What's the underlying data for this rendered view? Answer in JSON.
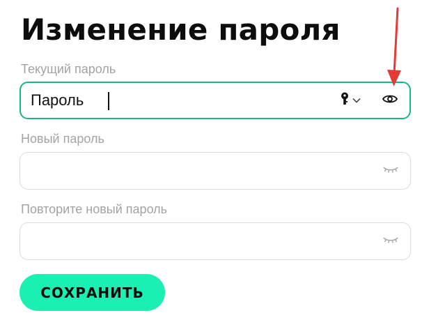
{
  "page": {
    "title": "Изменение пароля"
  },
  "current_password": {
    "label": "Текущий пароль",
    "value": "Пароль",
    "placeholder": ""
  },
  "new_password": {
    "label": "Новый пароль",
    "value": "",
    "placeholder": ""
  },
  "repeat_password": {
    "label": "Повторите новый пароль",
    "value": "",
    "placeholder": ""
  },
  "actions": {
    "save_label": "СОХРАНИТЬ"
  },
  "icons": {
    "current_field_key": "key-icon",
    "current_field_dropdown": "chevron-down-icon",
    "current_field_visibility": "eye-open-icon",
    "new_field_visibility": "eye-closed-icon",
    "repeat_field_visibility": "eye-closed-icon"
  },
  "colors": {
    "accent": "#19f0b1",
    "focus_border": "#15b985",
    "annotation_arrow": "#e53935"
  }
}
